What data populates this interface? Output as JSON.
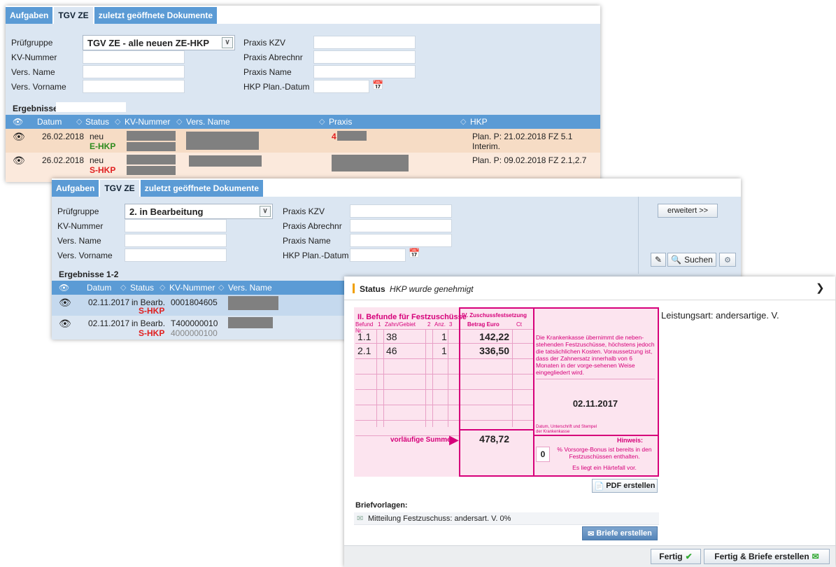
{
  "panel1": {
    "tabs": [
      "Aufgaben",
      "TGV ZE",
      "zuletzt geöffnete Dokumente"
    ],
    "labels": {
      "pruefgruppe": "Prüfgruppe",
      "kv_nummer": "KV-Nummer",
      "vers_name": "Vers. Name",
      "vers_vorname": "Vers. Vorname",
      "praxis_kzv": "Praxis KZV",
      "praxis_abrechnr": "Praxis Abrechnr",
      "praxis_name": "Praxis Name",
      "hkp_plan_datum": "HKP Plan.-Datum"
    },
    "pruefgruppe_value": "TGV ZE - alle neuen ZE-HKP",
    "results_label": "Ergebnisse",
    "columns": [
      "Datum",
      "Status",
      "KV-Nummer",
      "Vers. Name",
      "Praxis",
      "HKP"
    ],
    "rows": [
      {
        "datum": "26.02.2018",
        "status": "neu",
        "status2": "E-HKP",
        "praxis": "4",
        "hkp": "Plan. P: 21.02.2018 FZ 5.1 Interim."
      },
      {
        "datum": "26.02.2018",
        "status": "neu",
        "status2": "S-HKP",
        "praxis": "",
        "hkp": "Plan. P: 09.02.2018 FZ 2.1,2.7"
      }
    ]
  },
  "panel2": {
    "tabs": [
      "Aufgaben",
      "TGV ZE",
      "zuletzt geöffnete Dokumente"
    ],
    "labels": {
      "pruefgruppe": "Prüfgruppe",
      "kv_nummer": "KV-Nummer",
      "vers_name": "Vers. Name",
      "vers_vorname": "Vers. Vorname",
      "praxis_kzv": "Praxis KZV",
      "praxis_abrechnr": "Praxis Abrechnr",
      "praxis_name": "Praxis Name",
      "hkp_plan_datum": "HKP Plan.-Datum"
    },
    "pruefgruppe_value": "2. in Bearbeitung",
    "erweitert": "erweitert >>",
    "suchen": "Suchen",
    "results_label": "Ergebnisse",
    "results_count": "1-2",
    "columns": [
      "Datum",
      "Status",
      "KV-Nummer",
      "Vers. Name"
    ],
    "rows": [
      {
        "datum": "02.11.2017",
        "status": "in Bearb.",
        "status2": "S-HKP",
        "kv": "0001804605",
        "kv2": ""
      },
      {
        "datum": "02.11.2017",
        "status": "in Bearb.",
        "status2": "S-HKP",
        "kv": "T400000010",
        "kv2": "4000000100"
      }
    ]
  },
  "panel3": {
    "status_label": "Status",
    "status_value": "HKP wurde genehmigt",
    "leistungsart": "Leistungsart: andersartige. V.",
    "form": {
      "section2_title": "II. Befunde für Festzuschüsse",
      "section4_title": "IV. Zuschussfestsetzung",
      "col_befund": "Befund Nr.",
      "col_befund_num": "1",
      "col_zahn": "Zahn/Gebiet",
      "col_2": "2",
      "col_anz": "Anz.",
      "col_anz_num": "3",
      "col_betrag": "Betrag Euro",
      "col_ct": "Ct",
      "rows": [
        {
          "befund": "1.1",
          "zahn": "38",
          "anz": "1",
          "betrag": "142,22"
        },
        {
          "befund": "2.1",
          "zahn": "46",
          "anz": "1",
          "betrag": "336,50"
        }
      ],
      "summe_label": "vorläufige Summe",
      "summe_value": "478,72",
      "info_text": "Die Krankenkasse übernimmt die neben-stehenden Festzuschüsse, höchstens jedoch die tatsächlichen Kosten. Voraussetzung ist, dass der Zahnersatz innerhalb von 6 Monaten in der vorge-sehenen Weise eingegliedert wird.",
      "date": "02.11.2017",
      "signature_label": "Datum, Unterschrift und Stempel der Krankenkasse",
      "hinweis_title": "Hinweis:",
      "bonus_value": "0",
      "bonus_text": "% Vorsorge-Bonus ist bereits in den Festzuschüssen enthalten.",
      "haerte_text": "Es liegt ein Härtefall vor."
    },
    "pdf_button": "PDF erstellen",
    "briefvorlagen_label": "Briefvorlagen:",
    "brief_item": "Mitteilung Festzuschuss: andersart. V. 0%",
    "briefe_button": "Briefe erstellen",
    "fertig_button": "Fertig",
    "fertig_briefe_button": "Fertig & Briefe erstellen"
  },
  "colors": {
    "tab_blue": "#5b9bd5",
    "panel_bg": "#dbe6f2",
    "row_orange": "#f6dcc5",
    "row_selected": "#c5d9ee",
    "pink": "#d6007a",
    "status_red": "#e02020",
    "status_green": "#2e8b1e"
  }
}
